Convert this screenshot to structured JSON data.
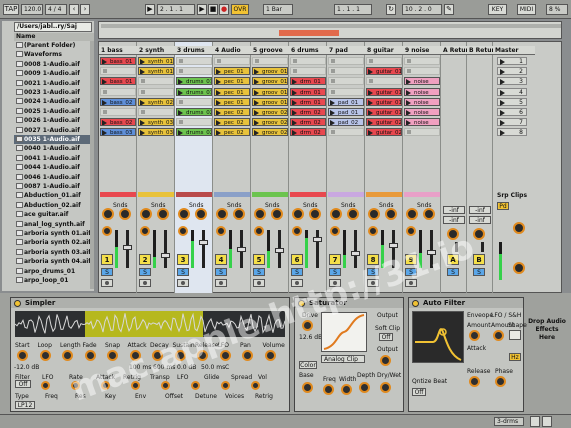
{
  "transport": {
    "tap_label": "TAP",
    "tempo": "120.0",
    "time_sig": "4 / 4",
    "position": "2 . 1 . 1",
    "ovr_label": "OVR",
    "quantize": "1 Bar",
    "loop_start": "1 . 1 . 1",
    "loop_length": "10 . 2 . 0",
    "key_label": "KEY",
    "midi_label": "MIDI",
    "cpu": "8 %"
  },
  "browser": {
    "path": "/Users/jabl..ry/Saj",
    "header": "Name",
    "items": [
      "(Parent Folder)",
      "Waveforms",
      "0008 1-Audio.aif",
      "0009 1-Audio.aif",
      "0021 1-Audio.aif",
      "0023 1-Audio.aif",
      "0024 1-Audio.aif",
      "0025 1-Audio.aif",
      "0026 1-Audio.aif",
      "0027 1-Audio.aif",
      "0035 1-Audio.aif",
      "0040 1-Audio.aif",
      "0041 1-Audio.aif",
      "0044 1-Audio.aif",
      "0046 1-Audio.aif",
      "0087 1-Audio.aif",
      "Abduction_01.aif",
      "Abduction_02.aif",
      "ace guitar.aif",
      "anal_log_synth.aif",
      "arboria synth 01.aif",
      "arboria synth 02.aif",
      "arboria synth 03.aif",
      "arboria synth 04.aif",
      "arpo_drums_01",
      "arpo_loop_01"
    ],
    "selected_index": 10
  },
  "tracks": [
    {
      "name": "1 bass",
      "color": "#e8484f",
      "num": "1",
      "clips": [
        {
          "r": 0,
          "t": "bass_01",
          "c": "#e8484f"
        },
        {
          "r": 2,
          "t": "bass_01",
          "c": "#e8484f"
        },
        {
          "r": 4,
          "t": "bass_02",
          "c": "#5e8fd9"
        },
        {
          "r": 6,
          "t": "bass_02",
          "c": "#e8484f"
        },
        {
          "r": 7,
          "t": "bass_03",
          "c": "#5e8fd9"
        }
      ],
      "level": 0.55
    },
    {
      "name": "2 synth",
      "color": "#e8c23a",
      "num": "2",
      "clips": [
        {
          "r": 0,
          "t": "synth_01",
          "c": "#e8c23a"
        },
        {
          "r": 1,
          "t": "synth_01",
          "c": "#e8c23a"
        },
        {
          "r": 4,
          "t": "synth_02",
          "c": "#e8c23a"
        },
        {
          "r": 6,
          "t": "synth_03",
          "c": "#e8c23a"
        },
        {
          "r": 7,
          "t": "synth_03",
          "c": "#e8c23a"
        }
      ],
      "level": 0.3
    },
    {
      "name": "3 drums",
      "color": "#b94a4a",
      "num": "3",
      "clips": [
        {
          "r": 2,
          "t": "drums_01",
          "c": "#6cc44f"
        },
        {
          "r": 3,
          "t": "drums_01",
          "c": "#6cc44f"
        },
        {
          "r": 5,
          "t": "drums_02",
          "c": "#6cc44f"
        },
        {
          "r": 7,
          "t": "drums_02",
          "c": "#6cc44f"
        }
      ],
      "level": 0.7
    },
    {
      "name": "4 Audio",
      "color": "#8aa0c8",
      "num": "4",
      "clips": [
        {
          "r": 1,
          "t": "pec_01",
          "c": "#e8c23a"
        },
        {
          "r": 2,
          "t": "pec_01",
          "c": "#e8c23a"
        },
        {
          "r": 3,
          "t": "pec_01",
          "c": "#e8c23a"
        },
        {
          "r": 4,
          "t": "pec_01",
          "c": "#e8c23a"
        },
        {
          "r": 5,
          "t": "pec_02",
          "c": "#e8c23a"
        },
        {
          "r": 6,
          "t": "pec_02",
          "c": "#e8c23a"
        },
        {
          "r": 7,
          "t": "pec_02",
          "c": "#e8c23a"
        }
      ],
      "level": 0.5
    },
    {
      "name": "5 groove",
      "color": "#6cc44f",
      "num": "5",
      "clips": [
        {
          "r": 1,
          "t": "groov_01",
          "c": "#e8c23a"
        },
        {
          "r": 2,
          "t": "groov_01",
          "c": "#e8c23a"
        },
        {
          "r": 3,
          "t": "groov_01",
          "c": "#e8c23a"
        },
        {
          "r": 4,
          "t": "groov_01",
          "c": "#e8c23a"
        },
        {
          "r": 5,
          "t": "groov_02",
          "c": "#e8c23a"
        },
        {
          "r": 6,
          "t": "groov_02",
          "c": "#e8c23a"
        },
        {
          "r": 7,
          "t": "groov_02",
          "c": "#e8c23a"
        }
      ],
      "level": 0.45
    },
    {
      "name": "6 drums",
      "color": "#e8484f",
      "num": "6",
      "clips": [
        {
          "r": 2,
          "t": "drm_01",
          "c": "#e8484f"
        },
        {
          "r": 3,
          "t": "drm_01",
          "c": "#e8484f"
        },
        {
          "r": 4,
          "t": "drm_01",
          "c": "#e8484f"
        },
        {
          "r": 5,
          "t": "drm_02",
          "c": "#e8484f"
        },
        {
          "r": 6,
          "t": "drm_02",
          "c": "#e8484f"
        },
        {
          "r": 7,
          "t": "drm_02",
          "c": "#e8484f"
        }
      ],
      "level": 0.8
    },
    {
      "name": "7 pad",
      "color": "#c9a8e0",
      "num": "7",
      "clips": [
        {
          "r": 4,
          "t": "pad_01",
          "c": "#b8c4e8"
        },
        {
          "r": 5,
          "t": "pad_01",
          "c": "#b8c4e8"
        },
        {
          "r": 6,
          "t": "pad_02",
          "c": "#b8c4e8"
        }
      ],
      "level": 0.35
    },
    {
      "name": "8 guitar",
      "color": "#e89a3a",
      "num": "8",
      "clips": [
        {
          "r": 1,
          "t": "guitar_01",
          "c": "#e8484f"
        },
        {
          "r": 3,
          "t": "guitar_01",
          "c": "#e8484f"
        },
        {
          "r": 4,
          "t": "guitar_01",
          "c": "#e8484f"
        },
        {
          "r": 5,
          "t": "guitar_01",
          "c": "#e8484f"
        },
        {
          "r": 6,
          "t": "guitar_02",
          "c": "#e8484f"
        },
        {
          "r": 7,
          "t": "guitar_02",
          "c": "#e8484f"
        }
      ],
      "level": 0.6
    },
    {
      "name": "9 noise",
      "color": "#e8a0c8",
      "num": "9",
      "clips": [
        {
          "r": 2,
          "t": "noise",
          "c": "#f0a0c0"
        },
        {
          "r": 3,
          "t": "noise",
          "c": "#f0a0c0"
        },
        {
          "r": 4,
          "t": "noise",
          "c": "#f0a0c0"
        },
        {
          "r": 5,
          "t": "noise",
          "c": "#f0a0c0"
        },
        {
          "r": 6,
          "t": "noise",
          "c": "#f0a0c0"
        }
      ],
      "level": 0.4
    }
  ],
  "returns": [
    {
      "name": "A Return",
      "letter": "A",
      "send_label": "-inf"
    },
    {
      "name": "B Return",
      "letter": "B",
      "send_label": "-inf"
    }
  ],
  "master": {
    "name": "Master",
    "scenes": [
      "1",
      "2",
      "3",
      "4",
      "5",
      "6",
      "7",
      "8"
    ]
  },
  "mixer": {
    "sends_label": "Snds",
    "srp_clips": "Srp Clips",
    "post": "Pd"
  },
  "simpler": {
    "title": "Simpler",
    "controls": [
      "Start",
      "Loop",
      "Length",
      "Fade",
      "Snap",
      "Attack",
      "Decay",
      "Sustain",
      "Release",
      "LFO",
      "Pan",
      "Volume"
    ],
    "values": [
      "100 ms",
      "600 ms",
      "0.0 dB",
      "50.0 ms",
      "C"
    ],
    "bottom": [
      "Filter",
      "LFO",
      "Rate",
      "Attack",
      "Retrig",
      "Transp",
      "LFO",
      "Glide",
      "Spread",
      "Vol"
    ],
    "bottom2": [
      "Type",
      "Freq",
      "Res",
      "Key",
      "Env",
      "Offset",
      "Detune",
      "Voices",
      "Retrig"
    ],
    "volume_val": "-12.0 dB",
    "filter_type": "LP12",
    "off_label": "Off"
  },
  "saturator": {
    "title": "Saturator",
    "drive_label": "Drive",
    "drive_val": "12.6 dB",
    "output_label": "Output",
    "soft_clip": "Soft Clip",
    "mode": "Analog Clip",
    "color_btn": "Color",
    "base": "Base",
    "freq": "Freq",
    "width": "Width",
    "depth": "Depth",
    "dry_wet": "Dry/Wet"
  },
  "autofilter": {
    "title": "Auto Filter",
    "envelope": "Enveope",
    "lfo": "LFO / S&H",
    "amount": "Amount",
    "attack": "Attack",
    "shape": "Shape",
    "release": "Release",
    "phase": "Phase",
    "quantize": "Qntize Beat",
    "drop_hint": "Drop Audio Effects Here",
    "off_label": "Off",
    "hz": "Hz"
  },
  "status": {
    "right": "3-drms"
  },
  "watermark": "mac.apple.http://31.io"
}
